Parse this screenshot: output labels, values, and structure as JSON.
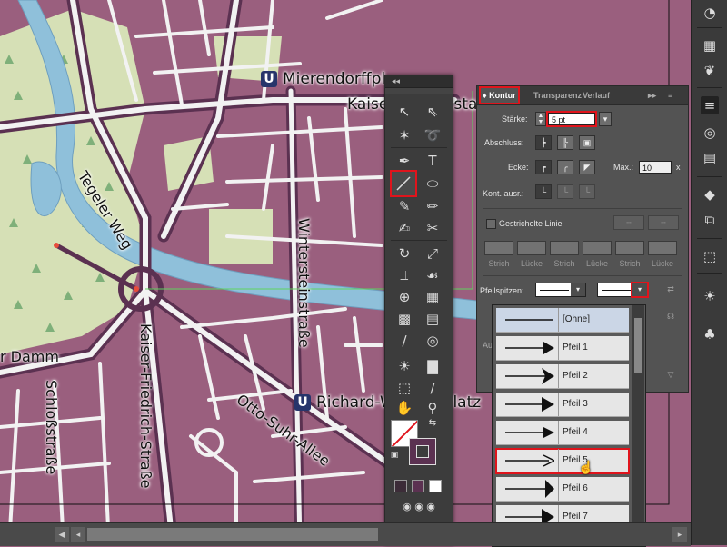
{
  "map": {
    "labels": {
      "mierendorff": "Mierendorffpl",
      "kaiserin_augusta": "Kaiserin-Augusta",
      "tegeler_weg": "Tegeler Weg",
      "wintersteinstrasse": "Wintersteinstraße",
      "tegeler_damm": "r Damm",
      "schlossstrasse": "Schloßstraße",
      "kaiser_friedrich": "Kaiser-Friedrich-Straße",
      "otto_suhr": "Otto-Suhr-Allee",
      "richard_wagner": "Richard-Wagner-Platz"
    },
    "ubahn_badge": "U",
    "colors": {
      "block": "#9a5f7e",
      "park": "#d6e0b6",
      "water": "#8fc0da",
      "road": "#f2f2f2",
      "road_outline": "#5b3151"
    }
  },
  "tools": {
    "header": "◂◂",
    "icons": [
      "selection-icon",
      "direct-selection-icon",
      "magic-wand-icon",
      "lasso-icon",
      "pen-icon",
      "type-icon",
      "line-segment-icon",
      "ellipse-icon",
      "paintbrush-icon",
      "pencil-icon",
      "shaper-icon",
      "scissors-icon",
      "rotate-icon",
      "scale-icon",
      "width-icon",
      "warp-icon",
      "shape-builder-icon",
      "perspective-icon",
      "mesh-icon",
      "gradient-icon",
      "eyedropper-icon",
      "blend-icon",
      "symbol-sprayer-icon",
      "graph-icon",
      "artboard-icon",
      "slice-icon",
      "hand-icon",
      "zoom-icon"
    ],
    "selected_tool": "line-segment-icon"
  },
  "kontur": {
    "tabs": [
      "Kontur",
      "Transparenz",
      "Verlauf"
    ],
    "staerke_label": "Stärke:",
    "staerke_value": "5 pt",
    "abschluss_label": "Abschluss:",
    "ecke_label": "Ecke:",
    "max_label": "Max.:",
    "max_value": "10",
    "max_unit": "x",
    "kont_label": "Kont. ausr.:",
    "gestrichelt_label": "Gestrichelte Linie",
    "dash_labels": [
      "Strich",
      "Lücke",
      "Strich",
      "Lücke",
      "Strich",
      "Lücke"
    ],
    "pfeilspitzen_label": "Pfeilspitzen:",
    "skalieren_label": "Ausr"
  },
  "arrow_list": {
    "items": [
      "[Ohne]",
      "Pfeil 1",
      "Pfeil 2",
      "Pfeil 3",
      "Pfeil 4",
      "Pfeil 5",
      "Pfeil 6",
      "Pfeil 7"
    ],
    "selected": "Pfeil 5"
  },
  "dock": {
    "icons": [
      "color-guide-icon",
      "swatches-grid-icon",
      "brushes-icon",
      "stroke-lines-icon",
      "pathfinder-icon",
      "gradient-swatch-icon",
      "layers-icon",
      "artboards-icon",
      "export-icon",
      "appearance-sun-icon",
      "symbols-club-icon"
    ]
  }
}
